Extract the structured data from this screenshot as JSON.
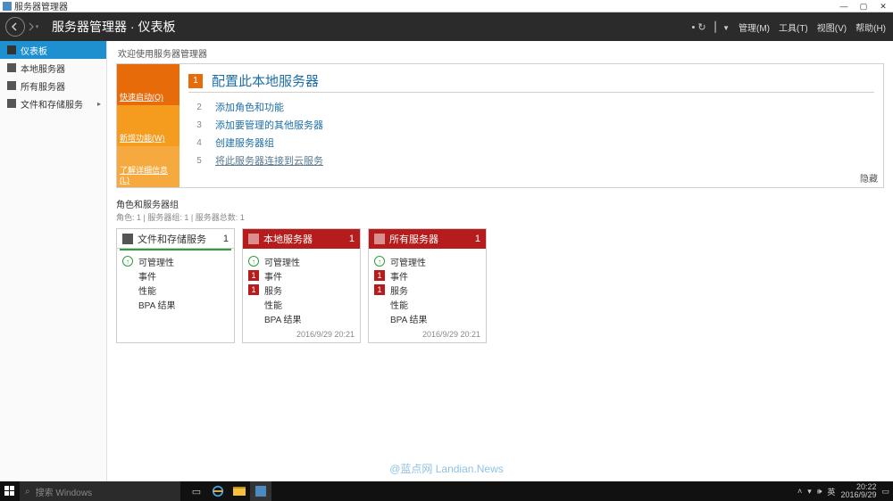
{
  "window": {
    "title": "服务器管理器"
  },
  "header": {
    "breadcrumb": "服务器管理器 · 仪表板",
    "menus": {
      "manage": "管理(M)",
      "tools": "工具(T)",
      "view": "视图(V)",
      "help": "帮助(H)"
    }
  },
  "sidebar": {
    "items": [
      {
        "label": "仪表板",
        "active": true
      },
      {
        "label": "本地服务器"
      },
      {
        "label": "所有服务器"
      },
      {
        "label": "文件和存储服务",
        "chevron": true
      }
    ]
  },
  "welcome": {
    "heading": "欢迎使用服务器管理器",
    "left": {
      "quick": "快速启动(Q)",
      "whatsnew": "新增功能(W)",
      "learn": "了解详细信息(L)"
    },
    "main_step": {
      "num": "1",
      "title": "配置此本地服务器"
    },
    "steps": [
      {
        "num": "2",
        "text": "添加角色和功能"
      },
      {
        "num": "3",
        "text": "添加要管理的其他服务器"
      },
      {
        "num": "4",
        "text": "创建服务器组"
      },
      {
        "num": "5",
        "text": "将此服务器连接到云服务",
        "underline": true
      }
    ],
    "hide": "隐藏"
  },
  "roles": {
    "title": "角色和服务器组",
    "subtitle": "角色: 1 | 服务器组: 1 | 服务器总数: 1"
  },
  "tiles": [
    {
      "head": "文件和存储服务",
      "count": "1",
      "style": "white",
      "rows": [
        {
          "badge": "ok",
          "text": "可管理性"
        },
        {
          "plain": true,
          "text": "事件"
        },
        {
          "plain": true,
          "text": "性能"
        },
        {
          "plain": true,
          "text": "BPA 结果"
        }
      ],
      "time": ""
    },
    {
      "head": "本地服务器",
      "count": "1",
      "style": "red",
      "rows": [
        {
          "badge": "ok",
          "text": "可管理性"
        },
        {
          "badge": "err",
          "badgetext": "1",
          "text": "事件"
        },
        {
          "badge": "err",
          "badgetext": "1",
          "text": "服务"
        },
        {
          "plain": true,
          "text": "性能"
        },
        {
          "plain": true,
          "text": "BPA 结果"
        }
      ],
      "time": "2016/9/29 20:21"
    },
    {
      "head": "所有服务器",
      "count": "1",
      "style": "red",
      "rows": [
        {
          "badge": "ok",
          "text": "可管理性"
        },
        {
          "badge": "err",
          "badgetext": "1",
          "text": "事件"
        },
        {
          "badge": "err",
          "badgetext": "1",
          "text": "服务"
        },
        {
          "plain": true,
          "text": "性能"
        },
        {
          "plain": true,
          "text": "BPA 结果"
        }
      ],
      "time": "2016/9/29 20:21"
    }
  ],
  "watermark": "@蓝点网  Landian.News",
  "taskbar": {
    "search_placeholder": "搜索 Windows",
    "ime": "英",
    "time": "20:22",
    "date": "2016/9/29"
  }
}
